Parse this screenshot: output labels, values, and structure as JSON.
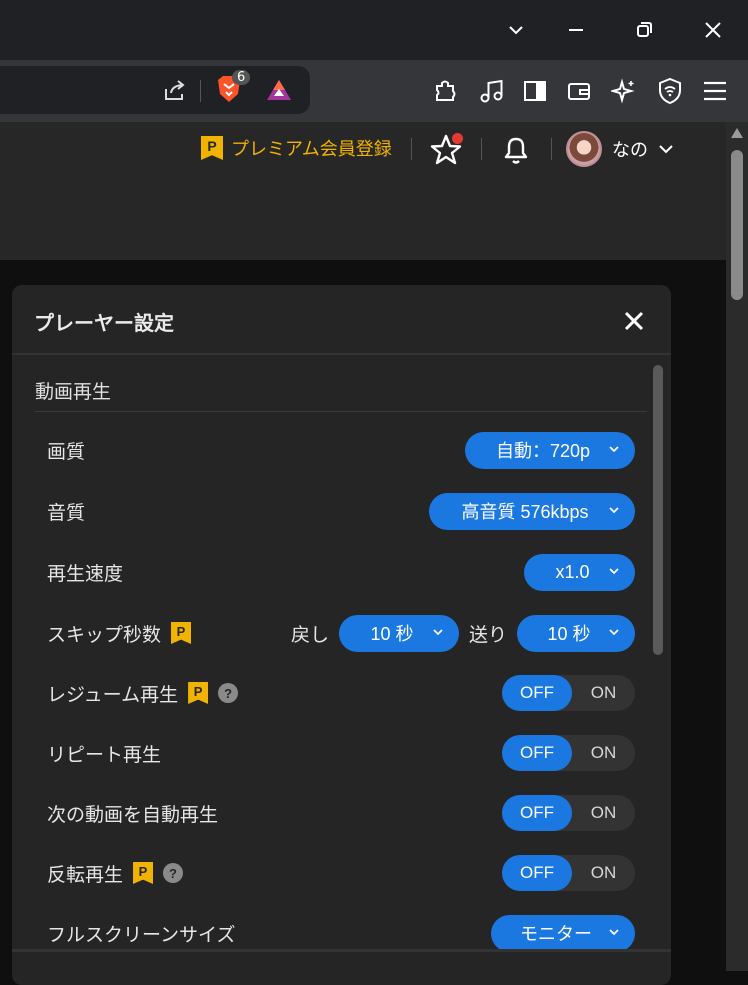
{
  "browser": {
    "shields_count": "6"
  },
  "header": {
    "premium_badge": "P",
    "premium_label": "プレミアム会員登録",
    "username": "なの"
  },
  "panel": {
    "title": "プレーヤー設定",
    "section_title": "動画再生",
    "rows": {
      "quality": {
        "label": "画質",
        "value": "自動：720p"
      },
      "audio": {
        "label": "音質",
        "value": "高音質 576kbps"
      },
      "speed": {
        "label": "再生速度",
        "value": "x1.0"
      },
      "skip": {
        "label": "スキップ秒数",
        "badge": "P",
        "back_label": "戻し",
        "back_value": "10 秒",
        "forward_label": "送り",
        "forward_value": "10 秒"
      },
      "resume": {
        "label": "レジューム再生",
        "badge": "P",
        "help": "?",
        "off": "OFF",
        "on": "ON"
      },
      "repeat": {
        "label": "リピート再生",
        "off": "OFF",
        "on": "ON"
      },
      "autoplay": {
        "label": "次の動画を自動再生",
        "off": "OFF",
        "on": "ON"
      },
      "mirror": {
        "label": "反転再生",
        "badge": "P",
        "help": "?",
        "off": "OFF",
        "on": "ON"
      },
      "fullscreen": {
        "label": "フルスクリーンサイズ",
        "value": "モニター"
      }
    }
  },
  "colors": {
    "accent": "#1a78e0",
    "premium": "#f0b300",
    "panel_bg": "#252525",
    "notify": "#e53935"
  }
}
